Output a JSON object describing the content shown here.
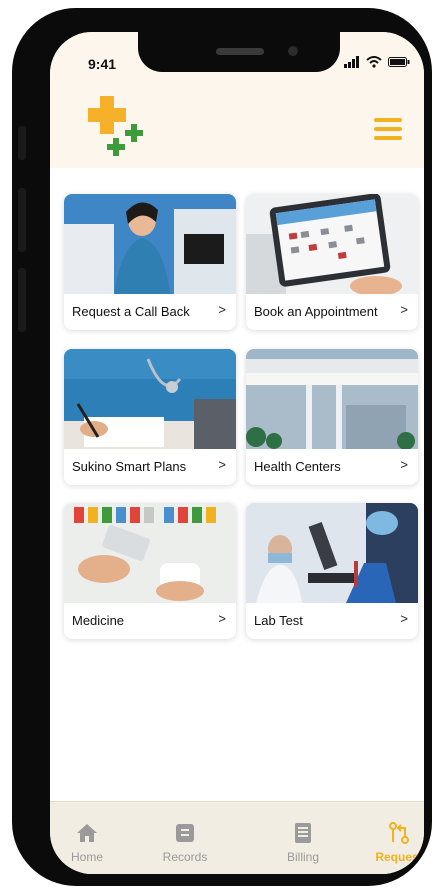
{
  "status_bar": {
    "time": "9:41"
  },
  "header": {
    "logo_icon": "medical-cross-logo",
    "menu_icon": "hamburger-menu-icon"
  },
  "services": [
    {
      "label": "Request a Call Back",
      "image": "nurse-on-phone"
    },
    {
      "label": "Book an Appointment",
      "image": "calendar-tablet"
    },
    {
      "label": "Sukino Smart Plans",
      "image": "nurse-writing"
    },
    {
      "label": "Health Centers",
      "image": "hospital-building"
    },
    {
      "label": "Medicine",
      "image": "medicine-shelf"
    },
    {
      "label": "Lab Test",
      "image": "lab-microscope"
    }
  ],
  "tabbar": {
    "tabs": [
      {
        "label": "Home",
        "icon": "home-icon"
      },
      {
        "label": "Records",
        "icon": "records-icon"
      },
      {
        "label": "Billing",
        "icon": "billing-icon"
      },
      {
        "label": "Request",
        "icon": "request-icon",
        "active": true
      }
    ]
  },
  "colors": {
    "accent": "#f2b21f",
    "green": "#3e9b3a",
    "header_bg": "#fcf6ec"
  }
}
